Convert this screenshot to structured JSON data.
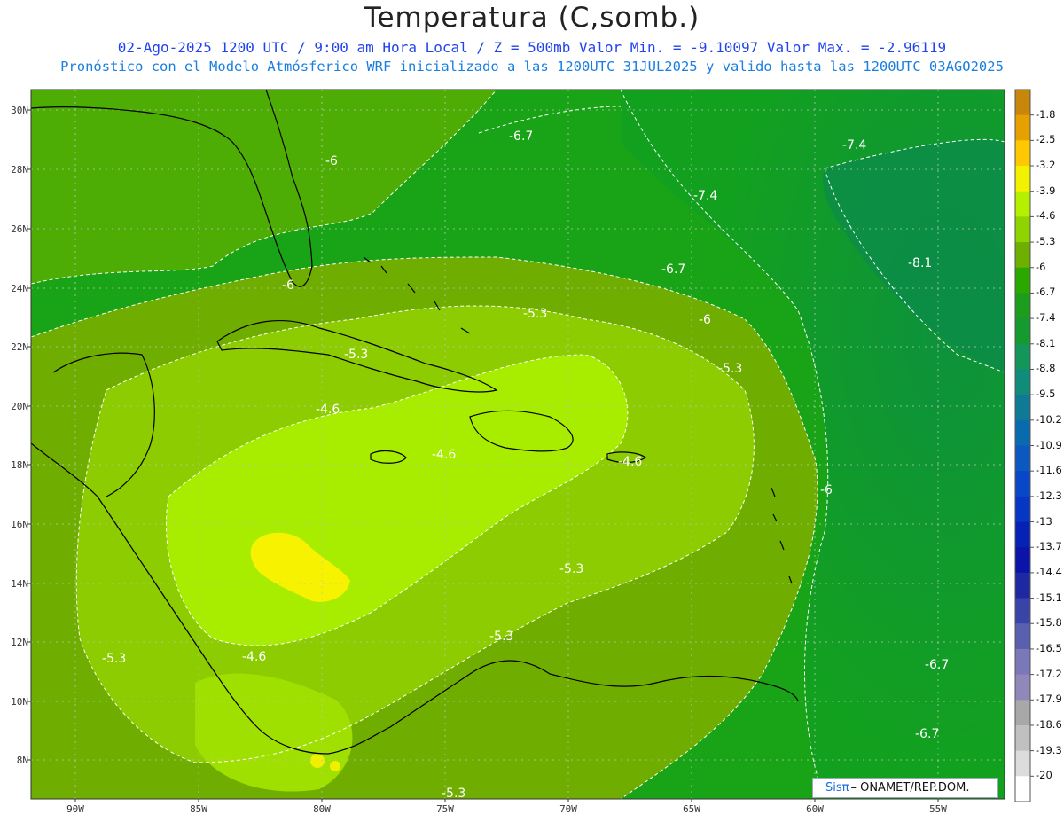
{
  "header": {
    "title": "Temperatura (C,somb.)",
    "subtitle_1": "02-Ago-2025  1200 UTC / 9:00 am Hora Local / Z = 500mb  Valor Min. = -9.10097  Valor Max. = -2.96119",
    "subtitle_2": "Pronóstico con el Modelo Atmósferico WRF inicializado a las 1200UTC_31JUL2025 y valido hasta las  1200UTC_03AGO2025"
  },
  "lat_labels": [
    "30N",
    "28N",
    "26N",
    "24N",
    "22N",
    "20N",
    "18N",
    "16N",
    "14N",
    "12N",
    "10N",
    "8N"
  ],
  "lon_labels": [
    "90W",
    "85W",
    "80W",
    "75W",
    "70W",
    "65W",
    "60W",
    "55W"
  ],
  "contour_labels": [
    "-6.7",
    "-7.4",
    "-6",
    "-7.4",
    "-6.7",
    "-8.1",
    "-6",
    "-5.3",
    "-6",
    "-5.3",
    "-5.3",
    "-4.6",
    "-4.6",
    "-4.6",
    "-6",
    "-5.3",
    "-5.3",
    "-4.6",
    "-5.3",
    "-6.7",
    "-6.7",
    "-5.3"
  ],
  "colorbar": {
    "labels": [
      "-1.8",
      "-2.5",
      "-3.2",
      "-3.9",
      "-4.6",
      "-5.3",
      "-6",
      "-6.7",
      "-7.4",
      "-8.1",
      "-8.8",
      "-9.5",
      "-10.2",
      "-10.9",
      "-11.6",
      "-12.3",
      "-13",
      "-13.7",
      "-14.4",
      "-15.1",
      "-15.8",
      "-16.5",
      "-17.2",
      "-17.9",
      "-18.6",
      "-19.3",
      "-20"
    ],
    "colors": [
      "#c8860a",
      "#e6a000",
      "#ffc800",
      "#f2f200",
      "#b5f000",
      "#8fd400",
      "#6db000",
      "#2aa800",
      "#1c9e1c",
      "#159a30",
      "#14955a",
      "#128c7a",
      "#0e7a96",
      "#0a6aae",
      "#0a58c0",
      "#0848c8",
      "#0636c4",
      "#0622b6",
      "#0a14a8",
      "#1e28a0",
      "#3a44a8",
      "#5a60b0",
      "#7a78b8",
      "#9088b8",
      "#a8a8a8",
      "#c0c0c0",
      "#dcdcdc",
      "#ffffff"
    ]
  },
  "credit": {
    "logo": "Sisπ",
    "text": "– ONAMET/REP.DOM."
  },
  "colors": {
    "ocean_green": "#13a213",
    "east_green": "#0c9c3a",
    "mid_green": "#7aac10",
    "light_green": "#a6dc0a",
    "yellow": "#f5f200",
    "contour_white": "#ffffff",
    "coast_black": "#000000"
  }
}
